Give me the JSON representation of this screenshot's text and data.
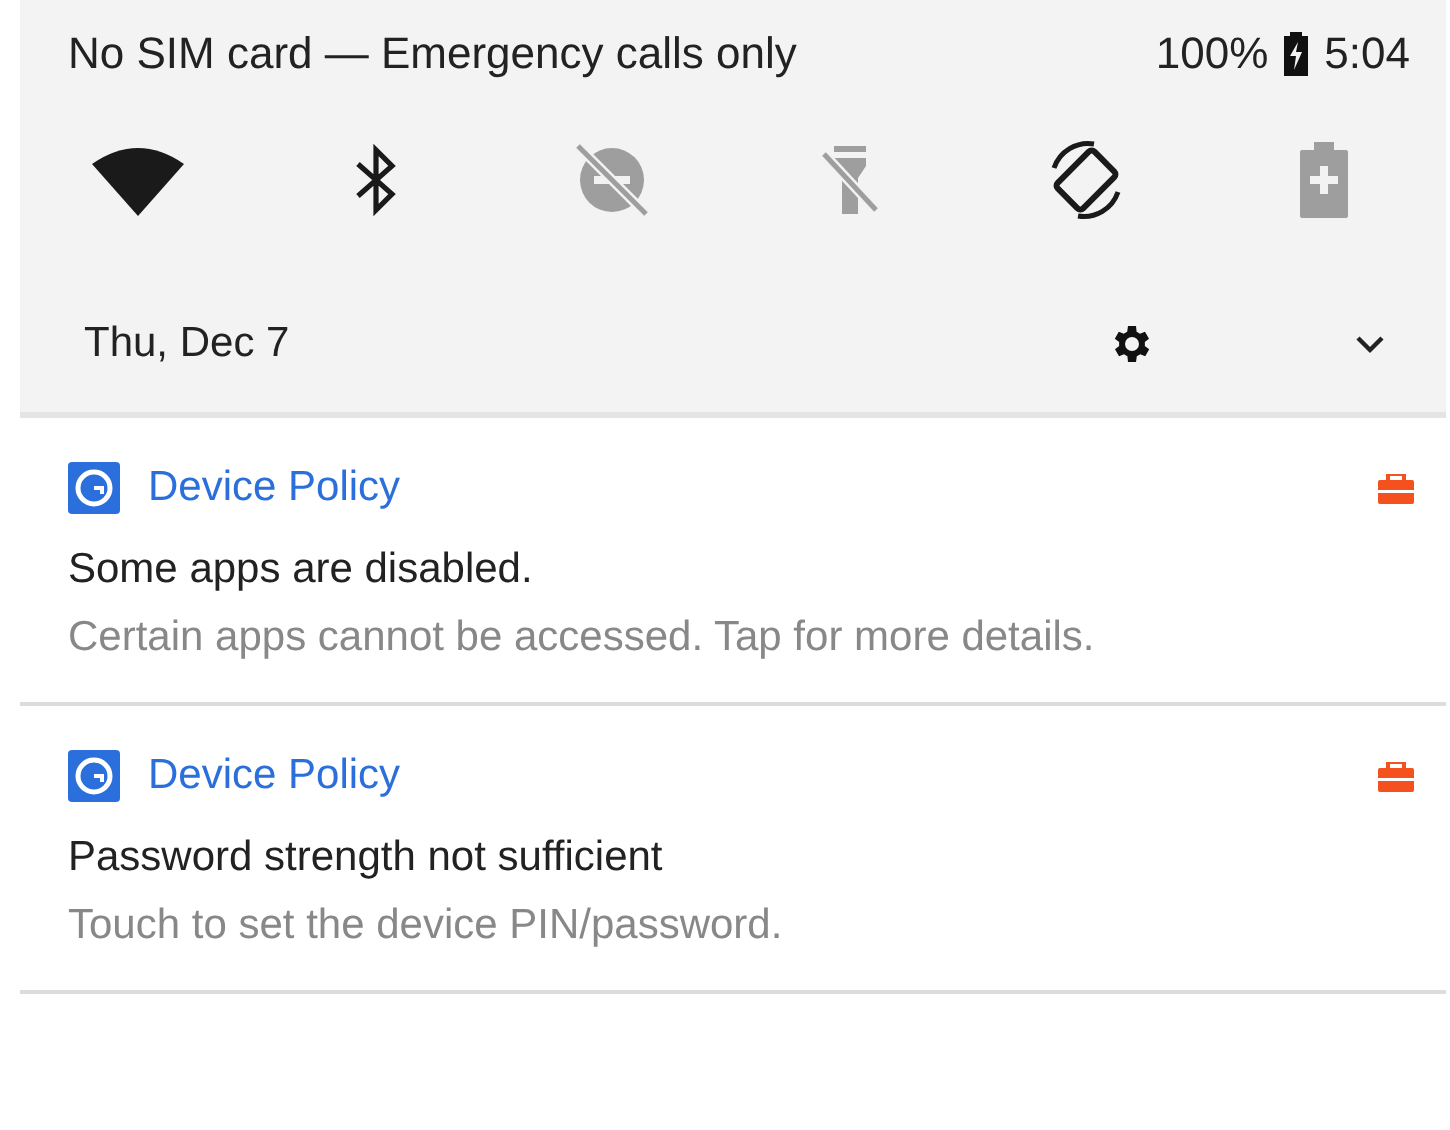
{
  "status_bar": {
    "carrier": "No SIM card — Emergency calls only",
    "battery": "100%",
    "time": "5:04"
  },
  "quick_tiles": [
    {
      "kind": "wifi",
      "on": true
    },
    {
      "kind": "bluetooth",
      "on": true
    },
    {
      "kind": "dnd",
      "on": false
    },
    {
      "kind": "flashlight",
      "on": false
    },
    {
      "kind": "rotate",
      "on": true
    },
    {
      "kind": "saver",
      "on": false
    }
  ],
  "date": "Thu, Dec 7",
  "notifications": [
    {
      "app": "Device Policy",
      "title": "Some apps are disabled.",
      "text": "Certain apps cannot be accessed. Tap for more details."
    },
    {
      "app": "Device Policy",
      "title": "Password strength not sufficient",
      "text": "Touch to set the device PIN/password."
    }
  ]
}
